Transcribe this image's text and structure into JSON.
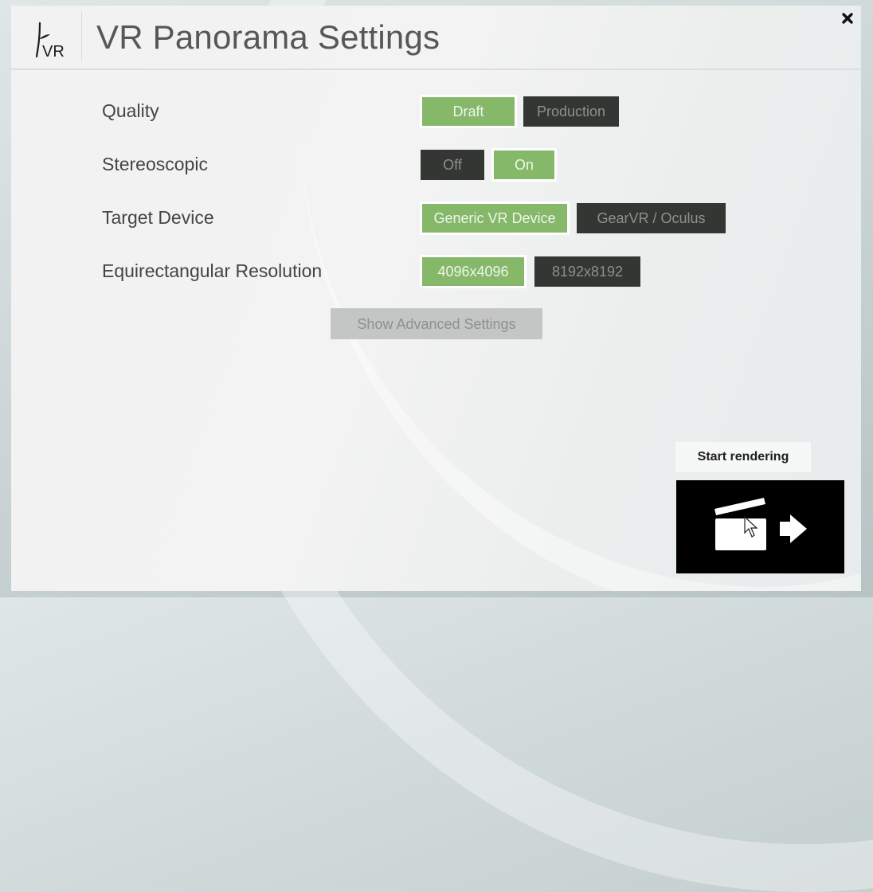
{
  "window": {
    "title": "VR Panorama Settings",
    "logo_text": "VR",
    "close_icon": "close-x-icon"
  },
  "settings": [
    {
      "label": "Quality",
      "options": [
        {
          "label": "Draft",
          "selected": true
        },
        {
          "label": "Production",
          "selected": false
        }
      ]
    },
    {
      "label": "Stereoscopic",
      "options": [
        {
          "label": "Off",
          "selected": false
        },
        {
          "label": "On",
          "selected": true
        }
      ]
    },
    {
      "label": "Target Device",
      "options": [
        {
          "label": "Generic VR Device",
          "selected": true
        },
        {
          "label": "GearVR / Oculus",
          "selected": false
        }
      ]
    },
    {
      "label": "Equirectangular Resolution",
      "options": [
        {
          "label": "4096x4096",
          "selected": true
        },
        {
          "label": "8192x8192",
          "selected": false
        }
      ]
    }
  ],
  "advanced_button": {
    "label": "Show Advanced Settings"
  },
  "render": {
    "label": "Start rendering",
    "icon": "clapperboard-arrow-icon"
  },
  "colors": {
    "selected": "#86b86a",
    "unselected": "#333633",
    "disabled": "#c4c6c5"
  }
}
